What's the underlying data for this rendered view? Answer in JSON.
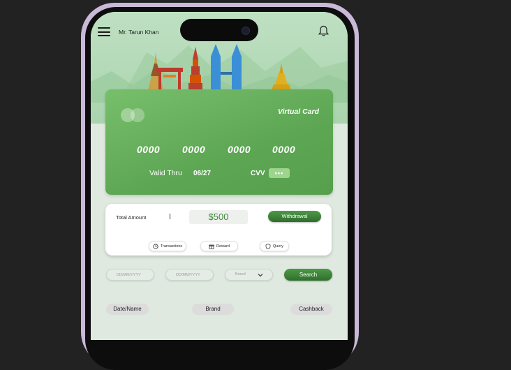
{
  "header": {
    "username": "Mr. Tarun Khan"
  },
  "icons": {
    "menu": "hamburger-menu-icon",
    "notifications": "bell-icon",
    "camera": "camera-icon"
  },
  "card": {
    "title": "Virtual Card",
    "number_groups": [
      "0000",
      "0000",
      "0000",
      "0000"
    ],
    "valid_label": "Valid Thru",
    "valid_value": "06/27",
    "cvv_label": "CVV",
    "cvv_value": "•••"
  },
  "summary": {
    "total_label": "Total Amount",
    "amount": "$500",
    "withdraw_label": "Withdrawal",
    "actions": [
      {
        "label": "Transactions",
        "icon": "transactions-icon"
      },
      {
        "label": "Reward",
        "icon": "gift-icon"
      },
      {
        "label": "Query",
        "icon": "shield-icon"
      }
    ]
  },
  "filters": {
    "from_date_placeholder": "DD/MM/YYYY",
    "to_date_placeholder": "DD/MM/YYYY",
    "brand_placeholder": "Brand",
    "search_label": "Search"
  },
  "table": {
    "columns": [
      "Date/Name",
      "Brand",
      "Cashback"
    ]
  },
  "colors": {
    "accent_green": "#3e8a3c",
    "card_green": "#5da653",
    "hero_green": "#bfe0c3",
    "phone_frame": "#c9b8d8"
  }
}
